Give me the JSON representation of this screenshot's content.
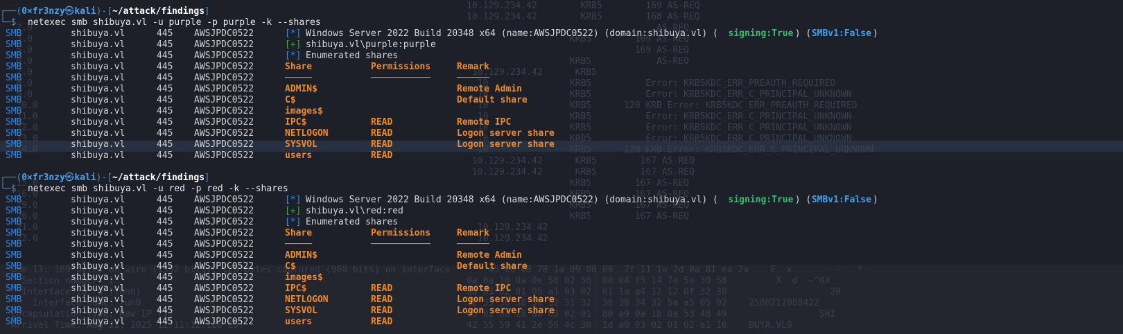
{
  "ghost": {
    "rows": [
      "                                                                                      10.129.234.42        KRB5        169 AS-REQ",
      "                                                                                      10.129.234.42        KRB5        168 AS-REQ",
      "   2.0                                                                                                                   AS-REQ",
      "   3.0                                                                                                   KRB5        169 AS-REQ",
      "   5.0                                                                                                               169 AS-REQ",
      "   6.0                                                                                                   KRB5            AS-REQ",
      "   7.0                                                                                 10.129.234.42      KRB5",
      "   8.0                                                                                  10               KRB5          Error: KRB5KDC_ERR_PREAUTH_REQUIRED",
      "   9.0                                                                                  10               KRB5          Error: KRB5KDC_ERR_C_PRINCIPAL_UNKNOWN",
      "   10.0                                                                                 10               KRB5      120 KRB Error: KRB5KDC_ERR_PREAUTH_REQUIRED",
      "   11.0                                                                                 10               KRB5          Error: KRB5KDC_ERR_C_PRINCIPAL_UNKNOWN",
      "   12.0                                                                                 10               KRB5          Error: KRB5KDC_ERR_C_PRINCIPAL_UNKNOWN",
      "   13.0                                                                                 10               KRB5          Error: KRB5KDC_ERR_C_PRINCIPAL_UNKNOWN",
      "   14.0                                                                                 10               KRB5      120 KRB Error: KRB5KDC_ERR_C_PRINCIPAL_UNKNOWN",
      "                                                                                       10.129.234.42      KRB5        167 AS-REQ",
      "                                                                                       10.129.234.42      KRB5        167 AS-REQ",
      "   15.0                                                                                                  KRB5        167 AS-REQ",
      "   16.0                                                                                                  KRB5        167 AS-REQ",
      "   19.0                                                                                                  KRB5        167 AS-REQ",
      "   20.0                                                                                                  KRB5        167 AS-REQ",
      "   21.0                                                                                 10.129.234.42",
      "   22.0                                                                                 10.129.234.42",
      "  ame 13: 169 bytes on wire (1352 bits), 128 bytes captured (960 bits) on interface       45 00 00 78 1a 09 00 00  7f 11 1a 2d 0a 81 ea 2a    E  x        -   *",
      "    Section number: 1                                                                 0a 0a 10 0a 0e 58 02 58  00 04 f5 14 7e 5e 30 58         X  d  ~^0X",
      "    Interface id: 0 (tun0)                                                            a0 03 02 01 05 a1 03 02  01 1a a4 12 12 0f 32 30                   20",
      "      Interface name: tun0                                                            32 35 30 38 38 32 31 32  38 38 34 32 5a a5 05 02    250821208842Z",
      "  Encapsulation type: Raw IP (7)                                                      05 02 0a 28 a0 03 02 01  80 a9 0a 1b 0a 53 48 49                 SHI",
      "  Arrival Time: Aug 21, 2025 12:11:12.128 EST                                         42 55 59 41 2e 56 4c 30  1d a0 03 02 01 02 a1 16    BUYA.VL0"
    ]
  },
  "session1": {
    "prompt": {
      "frame_top_left": "┌──(",
      "user": "0×fr3nzy",
      "at": "㉿",
      "host": "kali",
      "frame_mid": ")-[",
      "path": "~/attack/findings",
      "frame_end": "]",
      "frame_bottom": "└─$"
    },
    "command": "netexec smb shibuya.vl -u purple -p purple -k --shares",
    "rows": [
      {
        "proto": "SMB",
        "host": "shibuya.vl",
        "port": "445",
        "name": "AWSJPDC0522",
        "type": "banner",
        "mark": "[*]",
        "os": "Windows Server 2022 Build 20348 x64 (name:AWSJPDC0522) (domain:shibuya.vl) (",
        "signing": "signing:True",
        "mid": ") (",
        "smbv1": "SMBv1:False",
        "end": ")"
      },
      {
        "proto": "SMB",
        "host": "shibuya.vl",
        "port": "445",
        "name": "AWSJPDC0522",
        "type": "ok",
        "mark": "[+]",
        "text": "shibuya.vl\\purple:purple"
      },
      {
        "proto": "SMB",
        "host": "shibuya.vl",
        "port": "445",
        "name": "AWSJPDC0522",
        "type": "info",
        "mark": "[*]",
        "text": "Enumerated shares"
      },
      {
        "proto": "SMB",
        "host": "shibuya.vl",
        "port": "445",
        "name": "AWSJPDC0522",
        "type": "share",
        "share": "Share",
        "perm": "Permissions",
        "remark": "Remark"
      },
      {
        "proto": "SMB",
        "host": "shibuya.vl",
        "port": "445",
        "name": "AWSJPDC0522",
        "type": "share",
        "share": "─────",
        "perm": "───────────",
        "remark": "──────"
      },
      {
        "proto": "SMB",
        "host": "shibuya.vl",
        "port": "445",
        "name": "AWSJPDC0522",
        "type": "share",
        "share": "ADMIN$",
        "perm": "",
        "remark": "Remote Admin"
      },
      {
        "proto": "SMB",
        "host": "shibuya.vl",
        "port": "445",
        "name": "AWSJPDC0522",
        "type": "share",
        "share": "C$",
        "perm": "",
        "remark": "Default share"
      },
      {
        "proto": "SMB",
        "host": "shibuya.vl",
        "port": "445",
        "name": "AWSJPDC0522",
        "type": "share",
        "share": "images$",
        "perm": "",
        "remark": ""
      },
      {
        "proto": "SMB",
        "host": "shibuya.vl",
        "port": "445",
        "name": "AWSJPDC0522",
        "type": "share",
        "share": "IPC$",
        "perm": "READ",
        "remark": "Remote IPC"
      },
      {
        "proto": "SMB",
        "host": "shibuya.vl",
        "port": "445",
        "name": "AWSJPDC0522",
        "type": "share",
        "share": "NETLOGON",
        "perm": "READ",
        "remark": "Logon server share"
      },
      {
        "proto": "SMB",
        "host": "shibuya.vl",
        "port": "445",
        "name": "AWSJPDC0522",
        "type": "share",
        "share": "SYSVOL",
        "perm": "READ",
        "remark": "Logon server share"
      },
      {
        "proto": "SMB",
        "host": "shibuya.vl",
        "port": "445",
        "name": "AWSJPDC0522",
        "type": "share",
        "share": "users",
        "perm": "READ",
        "remark": ""
      }
    ]
  },
  "session2": {
    "prompt": {
      "frame_top_left": "┌──(",
      "user": "0×fr3nzy",
      "at": "㉿",
      "host": "kali",
      "frame_mid": ")-[",
      "path": "~/attack/findings",
      "frame_end": "]",
      "frame_bottom": "└─$"
    },
    "command": "netexec smb shibuya.vl -u red -p red -k --shares",
    "rows": [
      {
        "proto": "SMB",
        "host": "shibuya.vl",
        "port": "445",
        "name": "AWSJPDC0522",
        "type": "banner",
        "mark": "[*]",
        "os": "Windows Server 2022 Build 20348 x64 (name:AWSJPDC0522) (domain:shibuya.vl) (",
        "signing": "signing:True",
        "mid": ") (",
        "smbv1": "SMBv1:False",
        "end": ")"
      },
      {
        "proto": "SMB",
        "host": "shibuya.vl",
        "port": "445",
        "name": "AWSJPDC0522",
        "type": "ok",
        "mark": "[+]",
        "text": "shibuya.vl\\red:red"
      },
      {
        "proto": "SMB",
        "host": "shibuya.vl",
        "port": "445",
        "name": "AWSJPDC0522",
        "type": "info",
        "mark": "[*]",
        "text": "Enumerated shares"
      },
      {
        "proto": "SMB",
        "host": "shibuya.vl",
        "port": "445",
        "name": "AWSJPDC0522",
        "type": "share",
        "share": "Share",
        "perm": "Permissions",
        "remark": "Remark"
      },
      {
        "proto": "SMB",
        "host": "shibuya.vl",
        "port": "445",
        "name": "AWSJPDC0522",
        "type": "share",
        "share": "─────",
        "perm": "───────────",
        "remark": "──────"
      },
      {
        "proto": "SMB",
        "host": "shibuya.vl",
        "port": "445",
        "name": "AWSJPDC0522",
        "type": "share",
        "share": "ADMIN$",
        "perm": "",
        "remark": "Remote Admin"
      },
      {
        "proto": "SMB",
        "host": "shibuya.vl",
        "port": "445",
        "name": "AWSJPDC0522",
        "type": "share",
        "share": "C$",
        "perm": "",
        "remark": "Default share"
      },
      {
        "proto": "SMB",
        "host": "shibuya.vl",
        "port": "445",
        "name": "AWSJPDC0522",
        "type": "share",
        "share": "images$",
        "perm": "",
        "remark": ""
      },
      {
        "proto": "SMB",
        "host": "shibuya.vl",
        "port": "445",
        "name": "AWSJPDC0522",
        "type": "share",
        "share": "IPC$",
        "perm": "READ",
        "remark": "Remote IPC"
      },
      {
        "proto": "SMB",
        "host": "shibuya.vl",
        "port": "445",
        "name": "AWSJPDC0522",
        "type": "share",
        "share": "NETLOGON",
        "perm": "READ",
        "remark": "Logon server share"
      },
      {
        "proto": "SMB",
        "host": "shibuya.vl",
        "port": "445",
        "name": "AWSJPDC0522",
        "type": "share",
        "share": "SYSVOL",
        "perm": "READ",
        "remark": "Logon server share"
      },
      {
        "proto": "SMB",
        "host": "shibuya.vl",
        "port": "445",
        "name": "AWSJPDC0522",
        "type": "share",
        "share": "users",
        "perm": "READ",
        "remark": ""
      }
    ]
  },
  "colors": {
    "background": "#1e2029",
    "prompt_frame": "#3d8fd1",
    "smb_tag": "#2a86e8",
    "ok_mark": "#3aa84a",
    "share_orange": "#f08a24",
    "signing_green": "#2fbf71",
    "smbv1_cyan": "#38a3f5"
  }
}
